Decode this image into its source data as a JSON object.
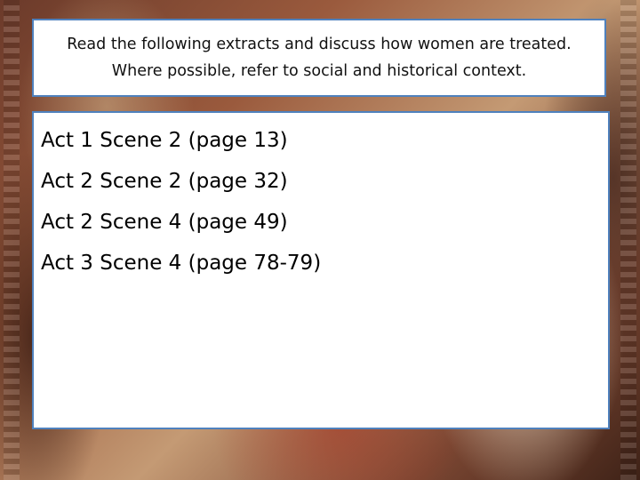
{
  "title": {
    "line1": "Read the following extracts and discuss how women are treated.",
    "line2": "Where possible, refer to social and historical context."
  },
  "extracts": [
    {
      "label": "Act 1 Scene 2 (page 13)"
    },
    {
      "label": "Act 2 Scene 2 (page 32)"
    },
    {
      "label": "Act 2 Scene 4 (page 49)"
    },
    {
      "label": "Act 3 Scene 4 (page 78-79)"
    }
  ],
  "colors": {
    "box_border": "#4f81bd",
    "box_fill": "#ffffff"
  }
}
